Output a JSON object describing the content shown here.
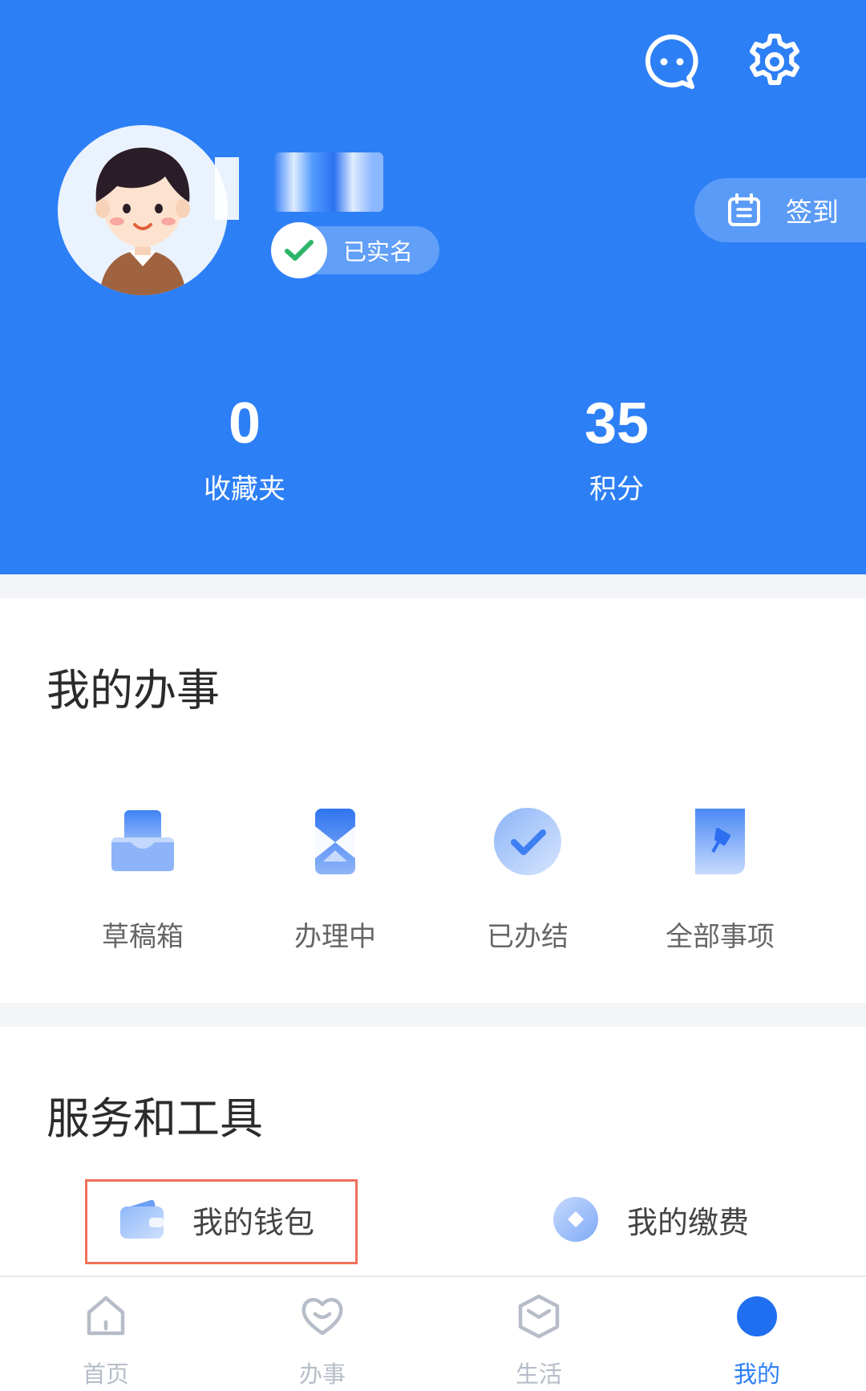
{
  "profile": {
    "verified_label": "已实名",
    "signin_label": "签到"
  },
  "stats": [
    {
      "value": "0",
      "label": "收藏夹"
    },
    {
      "value": "35",
      "label": "积分"
    }
  ],
  "my_tasks": {
    "title": "我的办事",
    "items": [
      {
        "label": "草稿箱",
        "icon": "draft-box-icon"
      },
      {
        "label": "办理中",
        "icon": "hourglass-icon"
      },
      {
        "label": "已办结",
        "icon": "check-circle-icon"
      },
      {
        "label": "全部事项",
        "icon": "document-pin-icon"
      }
    ]
  },
  "tools": {
    "title": "服务和工具",
    "items": [
      {
        "label": "我的钱包",
        "icon": "wallet-icon"
      },
      {
        "label": "我的缴费",
        "icon": "payment-icon"
      }
    ]
  },
  "tabbar": {
    "items": [
      {
        "label": "首页",
        "icon": "home-icon"
      },
      {
        "label": "办事",
        "icon": "heart-icon"
      },
      {
        "label": "生活",
        "icon": "box-icon"
      },
      {
        "label": "我的",
        "icon": "profile-dot-icon",
        "active": true
      }
    ]
  },
  "colors": {
    "primary": "#2d7ff6",
    "highlight_border": "#f0705b",
    "inactive_tab": "#b6bdc8"
  }
}
